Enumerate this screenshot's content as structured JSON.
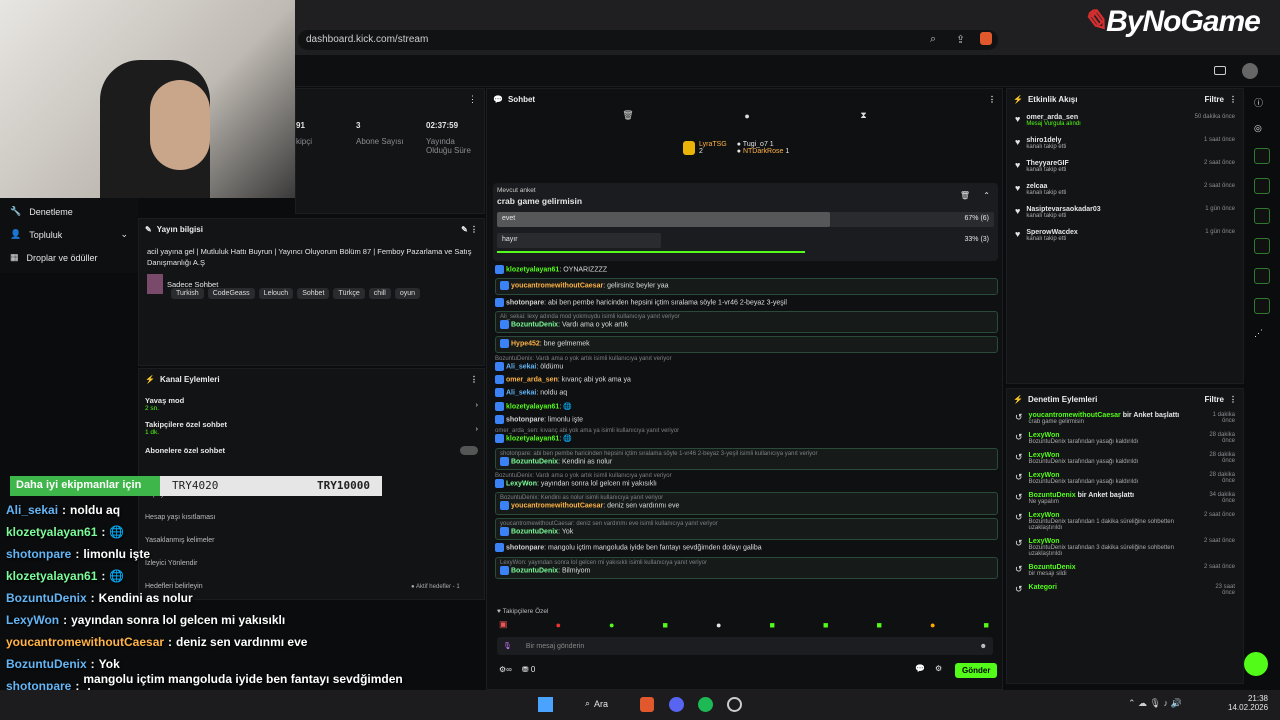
{
  "browser": {
    "url": "dashboard.kick.com/stream"
  },
  "watermark": "ByNoGame",
  "stats": {
    "items": [
      {
        "value": "91",
        "label": "kipçi"
      },
      {
        "value": "3",
        "label": "Abone Sayısı"
      },
      {
        "value": "02:37:59",
        "label": "Yayında Olduğu Süre"
      }
    ]
  },
  "left_nav": {
    "items": [
      {
        "label": "Denetleme"
      },
      {
        "label": "Topluluk"
      },
      {
        "label": "Droplar ve ödüller"
      }
    ]
  },
  "stream_info": {
    "title": "Yayın bilgisi",
    "stream_title": "acil yayına gel | Mutluluk Hattı Buyrun | Yayıncı Oluyorum Bölüm 87 | Femboy Pazarlama ve Satış Danışmanlığı A.Ş",
    "category": "Sadece Sohbet",
    "tags": [
      "Turkish",
      "CodeGeass",
      "Lelouch",
      "Sohbet",
      "Türkçe",
      "chill",
      "oyun"
    ]
  },
  "channel_actions": {
    "title": "Kanal Eylemleri",
    "items": [
      {
        "label": "Yavaş mod",
        "sub": "2 sn."
      },
      {
        "label": "Takipçilere özel sohbet",
        "sub": "1 dk."
      },
      {
        "label": "Abonelere özel sohbet",
        "sub": ""
      }
    ],
    "more": [
      "Yapay Zeka ile Sohbet Denetimi",
      "Hesap yaşı kısıtlaması",
      "Yasaklanmış kelimeler",
      "İzleyici Yönlendir",
      "Hedefleri belirleyin"
    ],
    "goals_label": "Aktif hedefler - 1"
  },
  "promo": {
    "text": "Daha iyi ekipmanlar için",
    "old_price": "TRY4020",
    "new_price": "TRY10000"
  },
  "chat": {
    "title": "Sohbet",
    "leaders": [
      {
        "name": "LyraTSG",
        "value": "2"
      },
      {
        "name": "Tugi_o7",
        "value": "1"
      },
      {
        "name": "NTDarkRose",
        "value": "1"
      }
    ],
    "poll": {
      "header": "Mevcut anket",
      "question": "crab game gelirmisin",
      "options": [
        {
          "label": "evet",
          "pct": "67% (6)",
          "fill": 0.67
        },
        {
          "label": "hayır",
          "pct": "33% (3)",
          "fill": 0.33
        }
      ]
    },
    "messages": [
      {
        "reply": "",
        "user": "klozetyalayan61",
        "text": "OYNARIZZZZ",
        "color": "#53fc18",
        "box": false
      },
      {
        "reply": "",
        "user": "youcantromewithoutCaesar",
        "text": "gelirsiniz beyler yaa",
        "color": "#ffb347",
        "box": true
      },
      {
        "reply": "",
        "user": "shotonpare",
        "text": "abi ben pembe haricinden hepsini içtim sıralama söyle 1-vr46 2-beyaz 3-yeşil",
        "color": "#cfcfcf",
        "box": false
      },
      {
        "reply": "Ali_sekai: lexy adında mod yokmuydu isimli kullanıcıya yanıt veriyor",
        "user": "BozuntuDenix",
        "text": "Vardı ama o yok artık",
        "color": "#7cfc9a",
        "box": true
      },
      {
        "reply": "",
        "user": "Hype452",
        "text": "bne gelmemek",
        "color": "#ffb347",
        "box": true
      },
      {
        "reply": "BozuntuDenix: Vardı ama o yok artık isimli kullanıcıya yanıt veriyor",
        "user": "Ali_sekai",
        "text": "öldümu",
        "color": "#64b5f6",
        "box": false
      },
      {
        "reply": "",
        "user": "omer_arda_sen",
        "text": "kıvanç abi yok ama ya",
        "color": "#ffb347",
        "box": false
      },
      {
        "reply": "",
        "user": "Ali_sekai",
        "text": "noldu aq",
        "color": "#64b5f6",
        "box": false
      },
      {
        "reply": "",
        "user": "klozetyalayan61",
        "text": "🌐",
        "color": "#53fc18",
        "box": false
      },
      {
        "reply": "",
        "user": "shotonpare",
        "text": "limonlu işte",
        "color": "#cfcfcf",
        "box": false
      },
      {
        "reply": "omer_arda_sen: kıvanç abi yok ama ya isimli kullanıcıya yanıt veriyor",
        "user": "klozetyalayan61",
        "text": "🌐",
        "color": "#53fc18",
        "box": false
      },
      {
        "reply": "shotonpare: abi ben pembe haricinden hepsini içtim sıralama söyle 1-vr46 2-beyaz 3-yeşil isimli kullanıcıya yanıt veriyor",
        "user": "BozuntuDenix",
        "text": "Kendini as nolur",
        "color": "#7cfc9a",
        "box": true
      },
      {
        "reply": "BozuntuDenix: Vardı ama o yok artık isimli kullanıcıya yanıt veriyor",
        "user": "LexyWon",
        "text": "yayından sonra lol gelcen mi yakısıklı",
        "color": "#7cfc9a",
        "box": false
      },
      {
        "reply": "BozuntuDenix: Kendini as nolur isimli kullanıcıya yanıt veriyor",
        "user": "youcantromewithoutCaesar",
        "text": "deniz sen vardınmı eve",
        "color": "#ffb347",
        "box": true
      },
      {
        "reply": "youcantromewithoutCaesar: deniz sen vardınmı eve isimli kullanıcıya yanıt veriyor",
        "user": "BozuntuDenix",
        "text": "Yok",
        "color": "#7cfc9a",
        "box": true
      },
      {
        "reply": "",
        "user": "shotonpare",
        "text": "mangolu içtim mangoluda iyide ben fantayı sevdğimden dolayı galiba",
        "color": "#cfcfcf",
        "box": false
      },
      {
        "reply": "LexyWon: yayından sonra lol gelcen mi yakısıklı isimli kullanıcıya yanıt veriyor",
        "user": "BozuntuDenix",
        "text": "Bilmiyom",
        "color": "#7cfc9a",
        "box": true
      }
    ],
    "follower_only": "Takipçilere Özel",
    "input_placeholder": "Bir mesaj gönderin",
    "send": "Gönder",
    "count": "0"
  },
  "activity": {
    "title": "Etkinlik Akışı",
    "filter": "Filtre",
    "items": [
      {
        "user": "omer_arda_sen",
        "action": "Mesaj Vurgula alındı",
        "time": "50 dakika önce",
        "accent": true
      },
      {
        "user": "shiro1dely",
        "action": "kanalı takip etti",
        "time": "1 saat önce",
        "accent": false
      },
      {
        "user": "TheyyareGIF",
        "action": "kanalı takip etti",
        "time": "2 saat önce",
        "accent": false
      },
      {
        "user": "zelcaa",
        "action": "kanalı takip etti",
        "time": "2 saat önce",
        "accent": false
      },
      {
        "user": "Nasiptevarsaokadar03",
        "action": "kanalı takip etti",
        "time": "1 gün önce",
        "accent": false
      },
      {
        "user": "SperowWacdex",
        "action": "kanalı takip etti",
        "time": "1 gün önce",
        "accent": false
      }
    ]
  },
  "mod_actions": {
    "title": "Denetim Eylemleri",
    "filter": "Filtre",
    "items": [
      {
        "user": "youcantromewithoutCaesar",
        "action": "bir Anket başlattı",
        "sub": "crab game gelirmisin",
        "time": "1 dakika önce"
      },
      {
        "user": "LexyWon",
        "action": "",
        "sub": "BozuntuDenix tarafından yasağı kaldırıldı",
        "time": "28 dakika önce"
      },
      {
        "user": "LexyWon",
        "action": "",
        "sub": "BozuntuDenix tarafından yasağı kaldırıldı",
        "time": "28 dakika önce"
      },
      {
        "user": "LexyWon",
        "action": "",
        "sub": "BozuntuDenix tarafından yasağı kaldırıldı",
        "time": "28 dakika önce"
      },
      {
        "user": "BozuntuDenix",
        "action": "bir Anket başlattı",
        "sub": "Ne yapalım",
        "time": "34 dakika önce"
      },
      {
        "user": "LexyWon",
        "action": "",
        "sub": "BozuntuDenix tarafından 1 dakika süreliğine sohbetten uzaklaştırıldı",
        "time": "2 saat önce"
      },
      {
        "user": "LexyWon",
        "action": "",
        "sub": "BozuntuDenix tarafından 3 dakika süreliğine sohbetten uzaklaştırıldı",
        "time": "2 saat önce"
      },
      {
        "user": "BozuntuDenix",
        "action": "",
        "sub": "bir mesajı sildi",
        "time": "2 saat önce"
      },
      {
        "user": "Kategori",
        "action": "",
        "sub": "",
        "time": "23 saat önce"
      }
    ]
  },
  "overlay_chat": [
    {
      "user": "Ali_sekai",
      "text": "noldu aq",
      "cls": "name-blue"
    },
    {
      "user": "klozetyalayan61",
      "text": "🌐",
      "cls": "name-grn"
    },
    {
      "user": "shotonpare",
      "text": "limonlu işte",
      "cls": "name-blue"
    },
    {
      "user": "klozetyalayan61",
      "text": "🌐",
      "cls": "name-grn"
    },
    {
      "user": "BozuntuDenix",
      "text": "Kendini as nolur",
      "cls": "name-blue"
    },
    {
      "user": "LexyWon",
      "text": "yayından sonra lol gelcen mi yakısıklı",
      "cls": "name-blue"
    },
    {
      "user": "youcantromewithoutCaesar",
      "text": "deniz sen vardınmı eve",
      "cls": "name-org"
    },
    {
      "user": "BozuntuDenix",
      "text": "Yok",
      "cls": "name-blue"
    },
    {
      "user": "shotonpare",
      "text": "mangolu içtim mangoluda iyide ben fantayı sevdğimden d",
      "cls": "name-blue"
    },
    {
      "user": "BozuntuDenix",
      "text": "Bilmiyom",
      "cls": "name-blue"
    }
  ],
  "taskbar": {
    "search": "Ara",
    "time": "21:38",
    "date": "14.02.2026"
  }
}
